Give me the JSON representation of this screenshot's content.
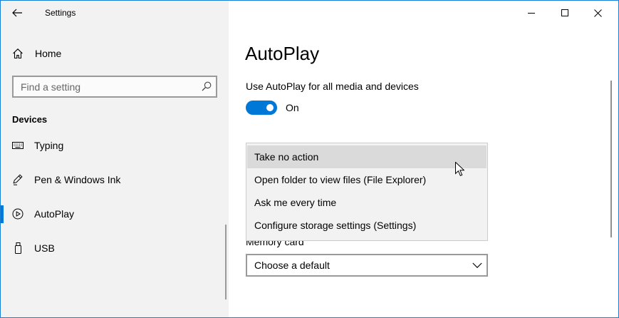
{
  "window": {
    "title": "Settings",
    "accent_color": "#0078d7",
    "controls": [
      "minimize-icon",
      "maximize-icon",
      "close-icon"
    ]
  },
  "sidebar": {
    "back_icon": "back-arrow-icon",
    "home": {
      "label": "Home",
      "icon": "home-icon"
    },
    "search": {
      "placeholder": "Find a setting",
      "value": "",
      "icon": "search-icon"
    },
    "section_title": "Devices",
    "items": [
      {
        "label": "Typing",
        "icon": "keyboard-icon",
        "selected": false
      },
      {
        "label": "Pen & Windows Ink",
        "icon": "pen-icon",
        "selected": false
      },
      {
        "label": "AutoPlay",
        "icon": "autoplay-icon",
        "selected": true
      },
      {
        "label": "USB",
        "icon": "usb-icon",
        "selected": false
      }
    ]
  },
  "main": {
    "page_title": "AutoPlay",
    "autoplay_toggle": {
      "label": "Use AutoPlay for all media and devices",
      "state_text": "On",
      "on": true
    },
    "dropdown_popup": {
      "options": [
        "Take no action",
        "Open folder to view files (File Explorer)",
        "Ask me every time",
        "Configure storage settings (Settings)"
      ],
      "highlighted_index": 0
    },
    "memory_card": {
      "label": "Memory card",
      "selected_value": "Choose a default",
      "icon": "chevron-down-icon"
    }
  }
}
